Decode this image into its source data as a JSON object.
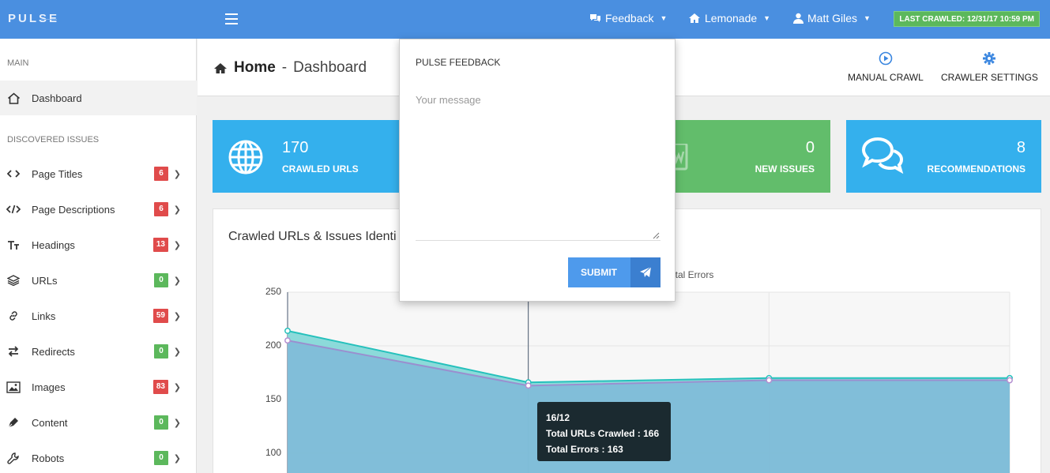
{
  "topbar": {
    "logo": "PULSE",
    "feedback_label": "Feedback",
    "project_label": "Lemonade",
    "user_label": "Matt Giles",
    "last_crawled": "LAST CRAWLED: 12/31/17 10:59 PM"
  },
  "sidebar": {
    "main_section": "MAIN",
    "dashboard_label": "Dashboard",
    "issues_section": "DISCOVERED ISSUES",
    "items": [
      {
        "label": "Page Titles",
        "count": "6",
        "status": "red",
        "icon": "code-icon"
      },
      {
        "label": "Page Descriptions",
        "count": "6",
        "status": "red",
        "icon": "code-slash-icon"
      },
      {
        "label": "Headings",
        "count": "13",
        "status": "red",
        "icon": "text-height-icon"
      },
      {
        "label": "URLs",
        "count": "0",
        "status": "green",
        "icon": "layers-icon"
      },
      {
        "label": "Links",
        "count": "59",
        "status": "red",
        "icon": "link-icon"
      },
      {
        "label": "Redirects",
        "count": "0",
        "status": "green",
        "icon": "exchange-icon"
      },
      {
        "label": "Images",
        "count": "83",
        "status": "red",
        "icon": "image-icon"
      },
      {
        "label": "Content",
        "count": "0",
        "status": "green",
        "icon": "pen-icon"
      },
      {
        "label": "Robots",
        "count": "0",
        "status": "green",
        "icon": "wrench-icon"
      }
    ]
  },
  "header": {
    "home": "Home",
    "separator": "-",
    "page": "Dashboard",
    "manual_crawl": "MANUAL CRAWL",
    "crawler_settings": "CRAWLER SETTINGS"
  },
  "cards": {
    "crawled_urls": {
      "value": "170",
      "label": "CRAWLED URLS"
    },
    "new_issues": {
      "value": "0",
      "label": "NEW ISSUES"
    },
    "recommendations": {
      "value": "8",
      "label": "RECOMMENDATIONS"
    }
  },
  "chart_panel": {
    "title": "Crawled URLs & Issues Identi",
    "legend_fragment": "otal Errors"
  },
  "chart_data": {
    "type": "area",
    "x": [
      "",
      "16/12",
      "",
      ""
    ],
    "series": [
      {
        "name": "Total URLs Crawled",
        "values": [
          214,
          166,
          170,
          170
        ],
        "color": "#2fc4c0"
      },
      {
        "name": "Total Errors",
        "values": [
          205,
          163,
          168,
          168
        ],
        "color": "#7fb8d6"
      }
    ],
    "yticks": [
      100,
      150,
      200,
      250
    ],
    "ylim": [
      85,
      250
    ],
    "grid": true
  },
  "tooltip": {
    "date": "16/12",
    "line1": "Total URLs Crawled : 166",
    "line2": "Total Errors : 163"
  },
  "feedback": {
    "title": "PULSE FEEDBACK",
    "placeholder": "Your message",
    "submit_label": "SUBMIT"
  },
  "colors": {
    "topbar": "#4a8fe0",
    "card_blue": "#34b0ed",
    "card_green": "#62bd6b",
    "badge_red": "#e04b4b",
    "badge_green": "#5cb85c"
  }
}
